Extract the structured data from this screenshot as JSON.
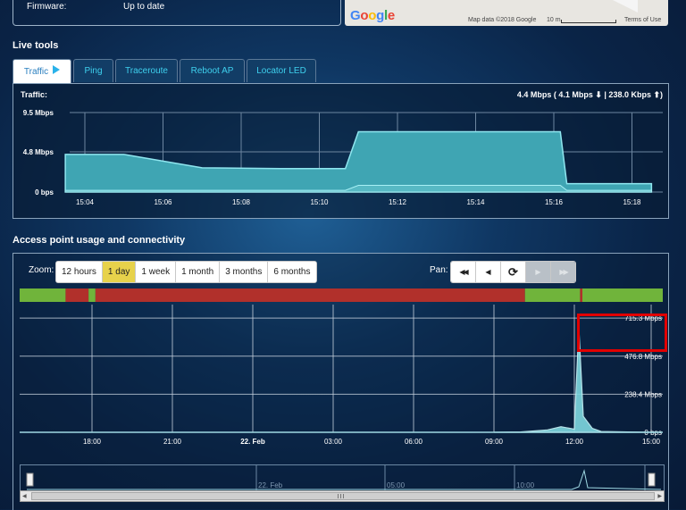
{
  "firmware": {
    "label": "Firmware:",
    "value": "Up to date"
  },
  "map": {
    "logo_letters": [
      "G",
      "o",
      "o",
      "g",
      "l",
      "e"
    ],
    "logo_colors": [
      "#4285f4",
      "#ea4335",
      "#fbbc05",
      "#4285f4",
      "#34a853",
      "#ea4335"
    ],
    "attribution": "Map data ©2018 Google",
    "scale": "10 m",
    "terms": "Terms of Use"
  },
  "live_tools": {
    "title": "Live tools",
    "tabs": [
      {
        "label": "Traffic",
        "active": true
      },
      {
        "label": "Ping"
      },
      {
        "label": "Traceroute"
      },
      {
        "label": "Reboot AP"
      },
      {
        "label": "Locator LED"
      }
    ]
  },
  "traffic": {
    "title": "Traffic:",
    "summary": "4.4 Mbps ( 4.1 Mbps ⬇ | 238.0 Kbps ⬆)",
    "y_labels": [
      "9.5 Mbps",
      "4.8 Mbps",
      "0 bps"
    ],
    "x_labels": [
      "15:04",
      "15:06",
      "15:08",
      "15:10",
      "15:12",
      "15:14",
      "15:16",
      "15:18"
    ]
  },
  "usage": {
    "title": "Access point usage and connectivity",
    "zoom_label": "Zoom:",
    "zoom_options": [
      {
        "label": "12 hours"
      },
      {
        "label": "1 day",
        "selected": true
      },
      {
        "label": "1 week"
      },
      {
        "label": "1 month"
      },
      {
        "label": "3 months"
      },
      {
        "label": "6 months"
      }
    ],
    "pan_label": "Pan:",
    "pan_buttons": [
      {
        "icon": "fast-back-icon",
        "glyph": "◀◀",
        "enabled": true
      },
      {
        "icon": "back-icon",
        "glyph": "◀",
        "enabled": true
      },
      {
        "icon": "refresh-icon",
        "glyph": "⟳",
        "enabled": true
      },
      {
        "icon": "forward-icon",
        "glyph": "▶",
        "enabled": false
      },
      {
        "icon": "fast-forward-icon",
        "glyph": "▶▶",
        "enabled": false
      }
    ],
    "y_labels": [
      "715.3 Mbps",
      "476.8 Mbps",
      "238.4 Mbps",
      "0 bps"
    ],
    "x_labels": [
      "18:00",
      "21:00",
      "22. Feb",
      "03:00",
      "06:00",
      "09:00",
      "12:00",
      "15:00"
    ],
    "navigator_labels": [
      "22. Feb",
      "05:00",
      "10:00"
    ]
  },
  "chart_data": [
    {
      "type": "area",
      "title": "Traffic:",
      "ylim": [
        0,
        9.5
      ],
      "x": [
        "15:03:30",
        "15:05",
        "15:07",
        "15:09",
        "15:10:40",
        "15:11",
        "15:13",
        "15:15",
        "15:16:10",
        "15:16:20",
        "15:18:30"
      ],
      "series": [
        {
          "values": [
            4.5,
            4.5,
            2.9,
            2.8,
            2.8,
            7.2,
            7.2,
            7.2,
            7.2,
            1.0,
            1.0
          ]
        },
        {
          "values": [
            0.2,
            0.2,
            0.2,
            0.2,
            0.2,
            0.8,
            0.8,
            0.8,
            0.8,
            0.2,
            0.2
          ]
        }
      ]
    },
    {
      "type": "area",
      "ylim": [
        0,
        800
      ],
      "x": [
        "09:00",
        "10:00",
        "11:00",
        "11:30",
        "12:00",
        "12:10",
        "12:20",
        "12:40",
        "13:00",
        "14:00",
        "15:00"
      ],
      "values": [
        0,
        2,
        15,
        35,
        20,
        660,
        100,
        25,
        5,
        2,
        0
      ],
      "connectivity": [
        {
          "from": "15:40",
          "to": "17:20",
          "status": "up"
        },
        {
          "from": "17:20",
          "to": "18:10",
          "status": "down"
        },
        {
          "from": "18:10",
          "to": "18:25",
          "status": "up"
        },
        {
          "from": "18:25",
          "to": "10:00",
          "status": "down"
        },
        {
          "from": "10:00",
          "to": "12:00",
          "status": "up"
        },
        {
          "from": "12:00",
          "to": "12:05",
          "status": "down"
        },
        {
          "from": "12:05",
          "to": "15:00",
          "status": "up"
        }
      ],
      "status_colors": {
        "up": "#70b43b",
        "down": "#b1302b"
      }
    }
  ]
}
